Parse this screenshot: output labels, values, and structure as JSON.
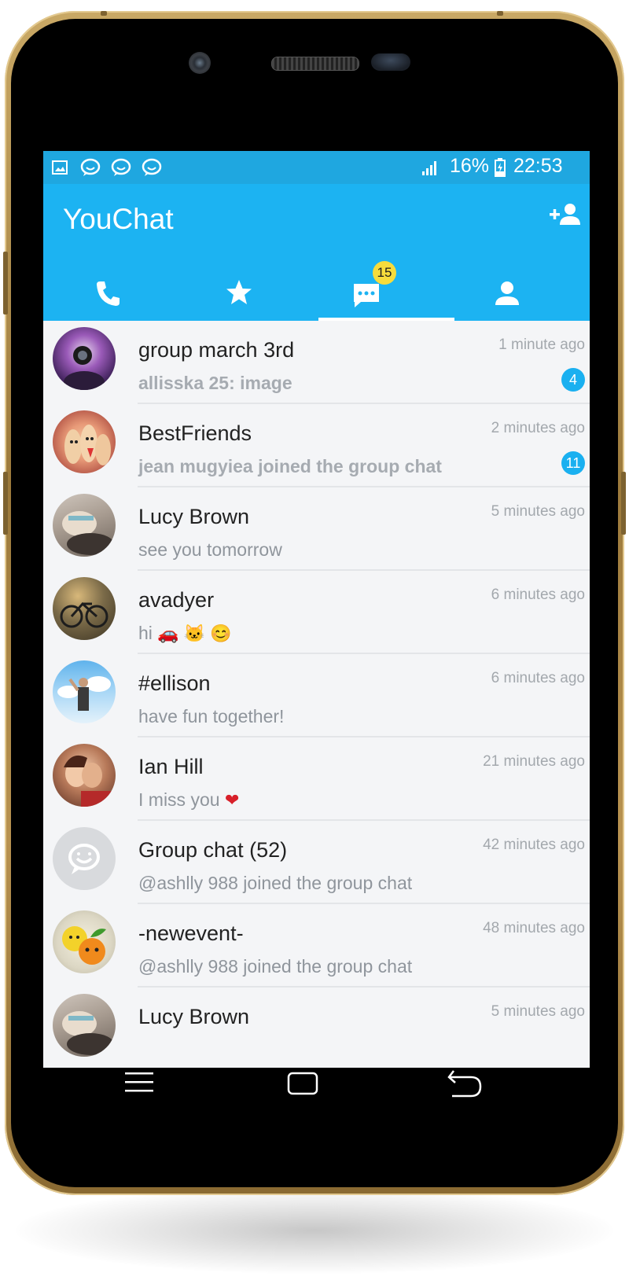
{
  "status_bar": {
    "battery": "16%",
    "time": "22:53",
    "icons": [
      "image-icon",
      "chat-icon",
      "chat-icon",
      "chat-icon",
      "signal-icon",
      "battery-icon"
    ]
  },
  "app_bar": {
    "title": "YouChat",
    "tabs": [
      {
        "name": "calls",
        "icon": "phone-icon"
      },
      {
        "name": "favorites",
        "icon": "star-icon"
      },
      {
        "name": "chats",
        "icon": "chat-bubble-icon",
        "badge": "15",
        "selected": true
      },
      {
        "name": "contacts",
        "icon": "person-icon"
      }
    ]
  },
  "chats": [
    {
      "name": "group march 3rd",
      "preview": "allisska 25: image",
      "time": "1 minute ago",
      "unread": "4",
      "avatar": "photo-camera-girl"
    },
    {
      "name": "BestFriends",
      "preview": "jean mugyiea joined the group chat",
      "time": "2 minutes ago",
      "unread": "11",
      "avatar": "photo-fingers"
    },
    {
      "name": "Lucy Brown",
      "preview": "see you tomorrow",
      "time": "5 minutes ago",
      "avatar": "photo-girl-hand"
    },
    {
      "name": "avadyer",
      "preview": "hi",
      "emojis": "🚗 🐱 😊",
      "time": "6 minutes ago",
      "avatar": "photo-bicycle"
    },
    {
      "name": "#ellison",
      "preview": "have fun together!",
      "time": "6 minutes ago",
      "avatar": "photo-sky"
    },
    {
      "name": "Ian Hill",
      "preview": "I miss you",
      "emojis": "❤",
      "time": "21 minutes ago",
      "avatar": "photo-couple"
    },
    {
      "name": "Group chat (52)",
      "preview": "@ashlly 988 joined the group chat",
      "time": "42 minutes ago",
      "avatar": "group-default"
    },
    {
      "name": "-newevent-",
      "preview": "@ashlly 988 joined the group chat",
      "time": "48 minutes ago",
      "avatar": "photo-fruit"
    },
    {
      "name": "Lucy Brown",
      "preview": "",
      "time": "5 minutes ago",
      "avatar": "photo-girl-hand"
    }
  ],
  "colors": {
    "status_bar": "#1fa7e0",
    "app_bar": "#1cb3f2",
    "unread_badge": "#1ab0f0",
    "tab_badge": "#f7dc3c",
    "frame_gold": "#b08d4c"
  },
  "navbar": {
    "icons": [
      "menu-icon",
      "home-icon",
      "back-icon"
    ]
  }
}
